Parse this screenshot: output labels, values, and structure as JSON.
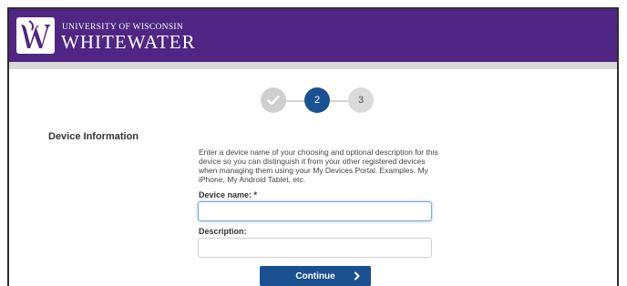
{
  "header": {
    "logo_icon": "uww-w-logo-icon",
    "university_line": "UNIVERSITY OF WISCONSIN",
    "campus_name": "WHITEWATER",
    "brand_color": "#4f2683"
  },
  "stepper": {
    "steps": [
      {
        "label": "",
        "state": "complete",
        "icon": "checkmark-icon"
      },
      {
        "label": "2",
        "state": "active"
      },
      {
        "label": "3",
        "state": "upcoming"
      }
    ],
    "active_color": "#1a5291"
  },
  "section": {
    "title": "Device Information"
  },
  "instructions": "Enter a device name of your choosing and optional description for this device so you can distinguish it from your other registered devices when managing them using your My Devices Portal. Examples. My iPhone, My Android Tablet, etc.",
  "form": {
    "device_name_label": "Device name: *",
    "device_name_value": "",
    "description_label": "Description:",
    "description_value": ""
  },
  "continue_button": {
    "label": "Continue",
    "icon": "chevron-right-icon"
  }
}
